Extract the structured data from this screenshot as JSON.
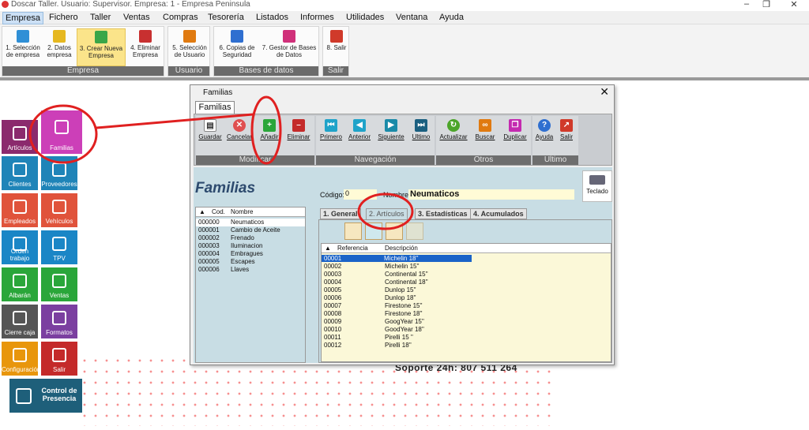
{
  "window": {
    "title": "Doscar Taller. Usuario: Supervisor. Empresa: 1 - Empresa Peninsula"
  },
  "menu": [
    "Empresa",
    "Fichero",
    "Taller",
    "Ventas",
    "Compras",
    "Tesorería",
    "Listados",
    "Informes",
    "Utilidades",
    "Ventana",
    "Ayuda"
  ],
  "ribbon": {
    "groups": [
      {
        "label": "Empresa",
        "buttons": [
          {
            "label": "1. Selección de empresa",
            "icon": "home-icon"
          },
          {
            "label": "2. Datos empresa",
            "icon": "folder-icon"
          },
          {
            "label": "3. Crear Nueva Empresa",
            "icon": "new-window-icon"
          },
          {
            "label": "4. Eliminar Empresa",
            "icon": "delete-doc-icon"
          }
        ]
      },
      {
        "label": "Usuario",
        "buttons": [
          {
            "label": "5. Selección de Usuario",
            "icon": "users-icon"
          }
        ]
      },
      {
        "label": "Bases de datos",
        "buttons": [
          {
            "label": "6. Copias de Seguridad",
            "icon": "lock-icon"
          },
          {
            "label": "7. Gestor de Bases de Datos",
            "icon": "database-icon"
          }
        ]
      },
      {
        "label": "Salir",
        "buttons": [
          {
            "label": "8. Salir",
            "icon": "exit-icon"
          }
        ]
      }
    ]
  },
  "tiles": [
    {
      "label": "Artículos",
      "color": "#8b2a6d"
    },
    {
      "label": "Familias",
      "color": "#cc3fb8"
    },
    {
      "label": "Clientes",
      "color": "#1f84b8"
    },
    {
      "label": "Proveedores",
      "color": "#1f84b8"
    },
    {
      "label": "Empleados",
      "color": "#e0533b"
    },
    {
      "label": "Vehículos",
      "color": "#e0533b"
    },
    {
      "label": "Orden trabajo",
      "color": "#1a86c6"
    },
    {
      "label": "TPV",
      "color": "#1a86c6"
    },
    {
      "label": "Albarán",
      "color": "#2aa63a"
    },
    {
      "label": "Ventas",
      "color": "#2aa63a"
    },
    {
      "label": "Cierre caja",
      "color": "#555555"
    },
    {
      "label": "Formatos",
      "color": "#7b3fa0"
    },
    {
      "label": "Configuración",
      "color": "#e8960c"
    },
    {
      "label": "Salir",
      "color": "#c42a2a"
    },
    {
      "label": "Control de Presencia",
      "color": "#1e5f7a"
    }
  ],
  "support_text": "Soporte 24h: 807 511 264",
  "dialog": {
    "title": "Familias",
    "tab": "Familias",
    "toolbar_groups": [
      {
        "label": "Modificar",
        "buttons": [
          {
            "label": "Guardar",
            "color": "#ffffff"
          },
          {
            "label": "Cancelar",
            "color": "#e05050"
          },
          {
            "label": "Añadir",
            "color": "#2aa63a"
          },
          {
            "label": "Eliminar",
            "color": "#c42a2a"
          }
        ]
      },
      {
        "label": "Navegación",
        "buttons": [
          {
            "label": "Primero",
            "color": "#1fa3c9"
          },
          {
            "label": "Anterior",
            "color": "#1fa3c9"
          },
          {
            "label": "Siguiente",
            "color": "#1a8aa8"
          },
          {
            "label": "Ultimo",
            "color": "#1a5f80"
          }
        ]
      },
      {
        "label": "Otros",
        "buttons": [
          {
            "label": "Actualizar",
            "color": "#4ca52a"
          },
          {
            "label": "Buscar",
            "color": "#e07a10"
          },
          {
            "label": "Duplicar",
            "color": "#c42ab0"
          }
        ]
      },
      {
        "label": "Ultimo",
        "buttons": [
          {
            "label": "Ayuda",
            "color": "#2f6fd0"
          },
          {
            "label": "Salir",
            "color": "#d03a2a"
          }
        ]
      }
    ],
    "form_title": "Familias",
    "codigo_label": "Código:",
    "codigo_value": "0",
    "nombre_label": "Nombre:",
    "nombre_value": "Neumaticos",
    "teclado_label": "Teclado",
    "list_headers": [
      "Cod.",
      "Nombre"
    ],
    "families": [
      [
        "000000",
        "Neumaticos"
      ],
      [
        "000001",
        "Cambio de Aceite"
      ],
      [
        "000002",
        "Frenado"
      ],
      [
        "000003",
        "Iluminacion"
      ],
      [
        "000004",
        "Embragues"
      ],
      [
        "000005",
        "Escapes"
      ],
      [
        "000006",
        "Llaves"
      ]
    ],
    "subtabs": [
      "1. General",
      "2. Artículos",
      "3. Estadísticas",
      "4. Acumulados"
    ],
    "articles_headers": [
      "Referencia",
      "Descripción"
    ],
    "articles": [
      [
        "00001",
        "Michelin 18''"
      ],
      [
        "00002",
        "Michelin 15''"
      ],
      [
        "00003",
        "Continental 15''"
      ],
      [
        "00004",
        "Continental 18''"
      ],
      [
        "00005",
        "Dunlop 15''"
      ],
      [
        "00006",
        "Dunlop 18''"
      ],
      [
        "00007",
        "Firestone 15''"
      ],
      [
        "00008",
        "Firestone 18''"
      ],
      [
        "00009",
        "GoogYear 15''"
      ],
      [
        "00010",
        "GoodYear 18''"
      ],
      [
        "00011",
        "Pirelli 15 ''"
      ],
      [
        "00012",
        "Pirelli 18''"
      ]
    ]
  }
}
